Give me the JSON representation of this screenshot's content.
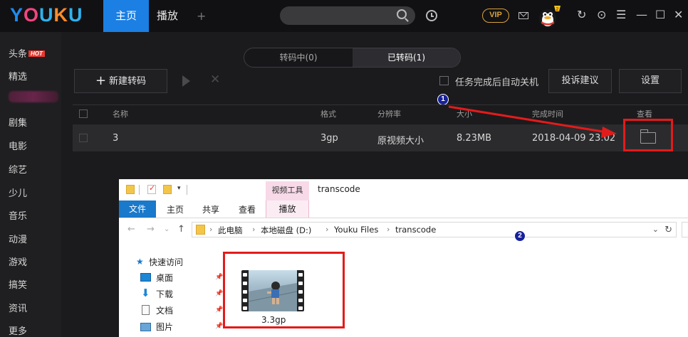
{
  "app": {
    "logo": {
      "y": "Y",
      "o1": "O",
      "u1": "U",
      "k": "K",
      "u2": "U"
    },
    "tabs": {
      "home": "主页",
      "play": "播放",
      "add": "+"
    },
    "vip": "VIP",
    "window_controls": {
      "refresh": "↻",
      "skin": "⊙",
      "menu": "☰",
      "minimize": "—",
      "maximize": "☐",
      "close": "✕"
    }
  },
  "sidebar": {
    "items": [
      {
        "label": "头条",
        "badge": "HOT"
      },
      {
        "label": "精选"
      },
      {
        "label": "剧集"
      },
      {
        "label": "电影"
      },
      {
        "label": "综艺"
      },
      {
        "label": "少儿"
      },
      {
        "label": "音乐"
      },
      {
        "label": "动漫"
      },
      {
        "label": "游戏"
      },
      {
        "label": "搞笑"
      },
      {
        "label": "资讯"
      },
      {
        "label": "更多"
      }
    ]
  },
  "transcode": {
    "segments": {
      "converting": "转码中(0)",
      "converted": "已转码(1)"
    },
    "toolbar": {
      "new_plus": "+",
      "new_label": "新建转码",
      "shutdown_label": "任务完成后自动关机",
      "complain_label": "投诉建议",
      "settings_label": "设置",
      "delete_glyph": "✕"
    },
    "table": {
      "headers": {
        "name": "名称",
        "format": "格式",
        "resolution": "分辨率",
        "size": "大小",
        "finished": "完成时间",
        "view": "查看"
      },
      "rows": [
        {
          "name": "3",
          "format": "3gp",
          "resolution": "原视频大小",
          "size": "8.23MB",
          "finished": "2018-04-09 23:02"
        }
      ]
    },
    "annotations": {
      "one": "1",
      "two": "2"
    }
  },
  "explorer": {
    "title": "transcode",
    "context_tab": "视频工具",
    "ribbon": {
      "file": "文件",
      "home": "主页",
      "share": "共享",
      "view": "查看",
      "play": "播放"
    },
    "address": {
      "pc": "此电脑",
      "disk": "本地磁盘 (D:)",
      "folder1": "Youku Files",
      "folder2": "transcode",
      "sep": "›"
    },
    "nav": {
      "quick_access": "快速访问",
      "items": [
        "桌面",
        "下载",
        "文档",
        "图片"
      ]
    },
    "file": {
      "name": "3.3gp"
    },
    "colors": {
      "file_tab": "#1979ca",
      "context": "#f7d9e8"
    }
  },
  "colors": {
    "accent": "#1b7fe3",
    "annotation_red": "#e31b1b",
    "badge_blue": "#17219a"
  }
}
